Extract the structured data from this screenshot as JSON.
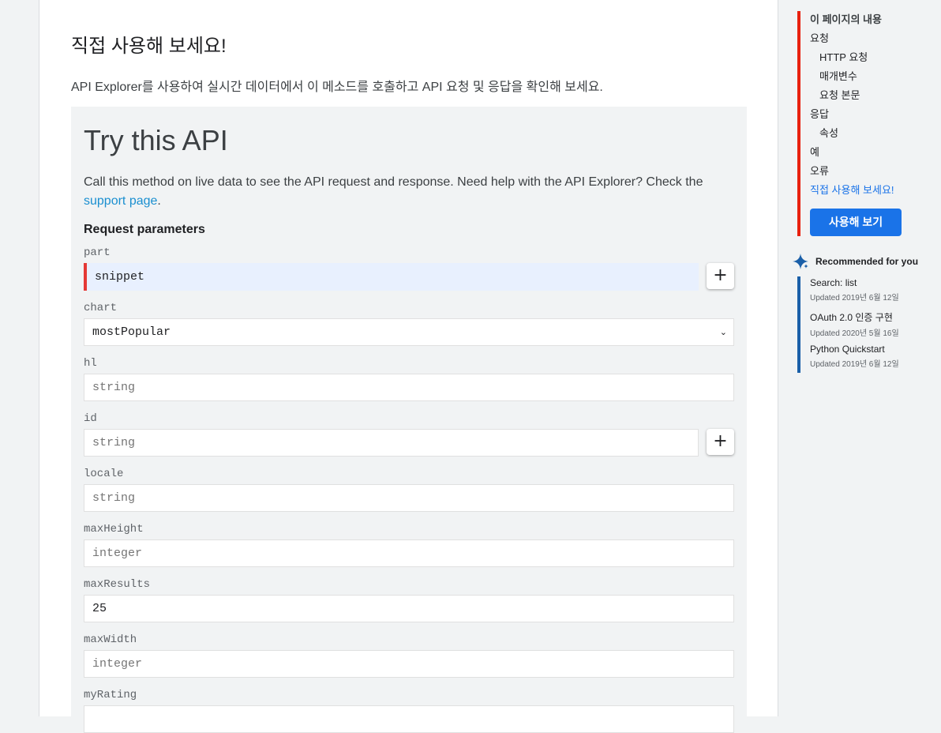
{
  "main": {
    "title": "직접 사용해 보세요!",
    "description": "API Explorer를 사용하여 실시간 데이터에서 이 메소드를 호출하고 API 요청 및 응답을 확인해 보세요."
  },
  "try_api": {
    "title": "Try this API",
    "desc_before": "Call this method on live data to see the API request and response. Need help with the API Explorer? Check the ",
    "support_link": "support page",
    "desc_after": ".",
    "request_params_title": "Request parameters",
    "add_symbol": "+",
    "select_chevron": "⌄",
    "params": {
      "part": {
        "label": "part",
        "value": "snippet"
      },
      "chart": {
        "label": "chart",
        "value": "mostPopular"
      },
      "hl": {
        "label": "hl",
        "placeholder": "string"
      },
      "id": {
        "label": "id",
        "placeholder": "string"
      },
      "locale": {
        "label": "locale",
        "placeholder": "string"
      },
      "maxHeight": {
        "label": "maxHeight",
        "placeholder": "integer"
      },
      "maxResults": {
        "label": "maxResults",
        "value": "25"
      },
      "maxWidth": {
        "label": "maxWidth",
        "placeholder": "integer"
      },
      "myRating": {
        "label": "myRating",
        "placeholder": ""
      }
    }
  },
  "toc": {
    "heading": "이 페이지의 내용",
    "items": [
      "요청",
      "HTTP 요청",
      "매개변수",
      "요청 본문",
      "응답",
      "속성",
      "예",
      "오류",
      "직접 사용해 보세요!"
    ],
    "button": "사용해 보기"
  },
  "recommended": {
    "heading": "Recommended for you",
    "items": [
      {
        "name": "Search: list",
        "updated": "Updated 2019년 6월 12일"
      },
      {
        "name": "OAuth 2.0 인증 구현",
        "updated": "Updated 2020년 5월 16일"
      },
      {
        "name": "Python Quickstart",
        "updated": "Updated 2019년 6월 12일"
      }
    ]
  },
  "colors": {
    "toc_accent": "#e8210f",
    "rec_accent": "#1a5fa8",
    "primary": "#1a73e8",
    "active_field": "#e8f0fe",
    "required_marker": "#e53935"
  }
}
